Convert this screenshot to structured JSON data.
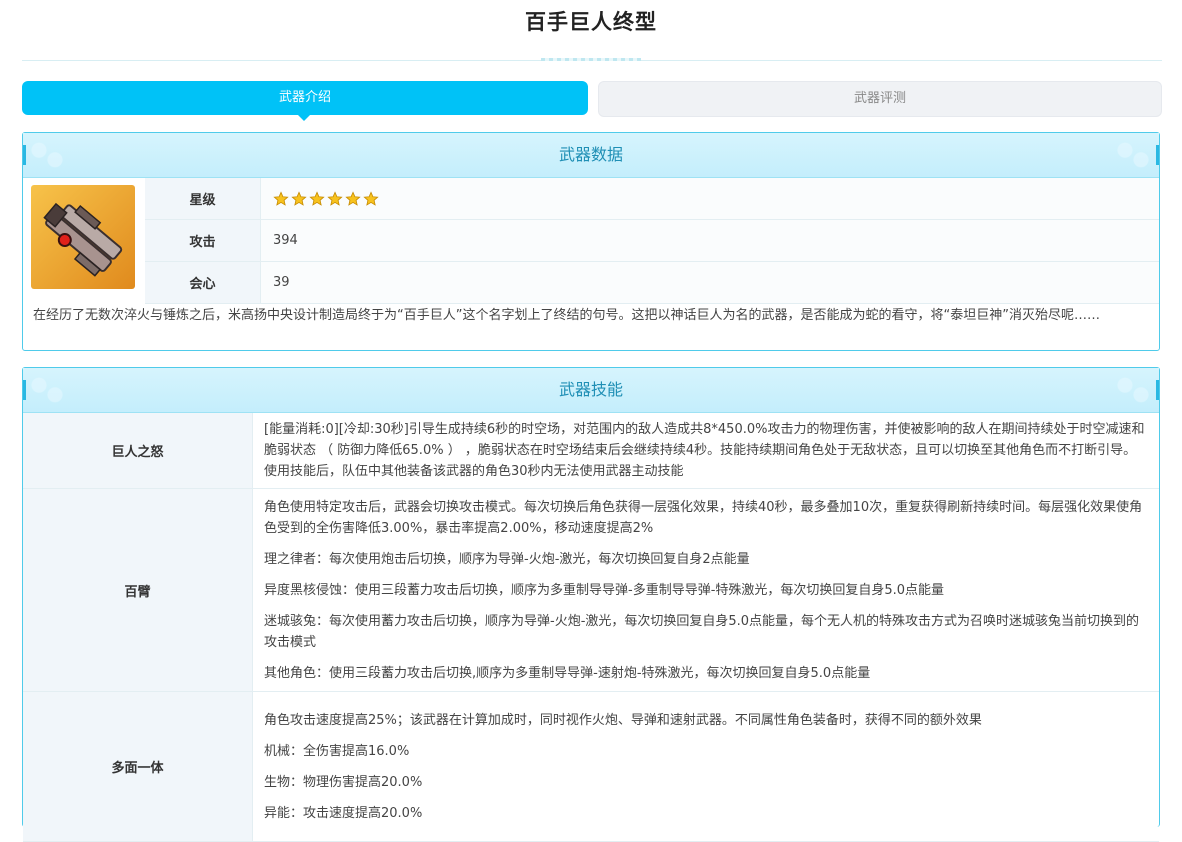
{
  "page": {
    "title": "百手巨人终型"
  },
  "tabs": [
    {
      "label": "武器介绍",
      "active": true
    },
    {
      "label": "武器评测",
      "active": false
    }
  ],
  "weapon_data": {
    "heading": "武器数据",
    "stats": [
      {
        "key": "星级",
        "value": "",
        "stars": 6
      },
      {
        "key": "攻击",
        "value": "394"
      },
      {
        "key": "会心",
        "value": "39"
      }
    ],
    "description": "在经历了无数次淬火与锤炼之后，米高扬中央设计制造局终于为“百手巨人”这个名字划上了终结的句号。这把以神话巨人为名的武器，是否能成为蛇的看守，将“泰坦巨神”消灭殆尽呢……"
  },
  "weapon_skills": {
    "heading": "武器技能",
    "skills": [
      {
        "name": "巨人之怒",
        "paragraphs": [
          "[能量消耗:0][冷却:30秒]引导生成持续6秒的时空场，对范围内的敌人造成共8*450.0%攻击力的物理伤害，并使被影响的敌人在期间持续处于时空减速和脆弱状态 （ 防御力降低65.0% ） ，脆弱状态在时空场结束后会继续持续4秒。技能持续期间角色处于无敌状态，且可以切换至其他角色而不打断引导。使用技能后，队伍中其他装备该武器的角色30秒内无法使用武器主动技能"
        ]
      },
      {
        "name": "百臂",
        "paragraphs": [
          "角色使用特定攻击后，武器会切换攻击模式。每次切换后角色获得一层强化效果，持续40秒，最多叠加10次，重复获得刷新持续时间。每层强化效果使角色受到的全伤害降低3.00%，暴击率提高2.00%，移动速度提高2%",
          "理之律者：每次使用炮击后切换，顺序为导弹-火炮-激光，每次切换回复自身2点能量",
          "异度黑核侵蚀：使用三段蓄力攻击后切换，顺序为多重制导导弹-多重制导导弹-特殊激光，每次切换回复自身5.0点能量",
          "迷城骇兔：每次使用蓄力攻击后切换，顺序为导弹-火炮-激光，每次切换回复自身5.0点能量，每个无人机的特殊攻击方式为召唤时迷城骇兔当前切换到的攻击模式",
          "其他角色：使用三段蓄力攻击后切换,顺序为多重制导导弹-速射炮-特殊激光，每次切换回复自身5.0点能量"
        ]
      },
      {
        "name": "多面一体",
        "paragraphs": [
          "角色攻击速度提高25%；该武器在计算加成时，同时视作火炮、导弹和速射武器。不同属性角色装备时，获得不同的额外效果",
          "机械：全伤害提高16.0%",
          "生物：物理伤害提高20.0%",
          "异能：攻击速度提高20.0%"
        ]
      }
    ]
  },
  "colors": {
    "accent": "#00c2f7",
    "panel_border": "#4fcbea",
    "star": "#f7c21e"
  },
  "icons": {
    "weapon": "weapon-thumbnail",
    "star": "star-icon"
  }
}
